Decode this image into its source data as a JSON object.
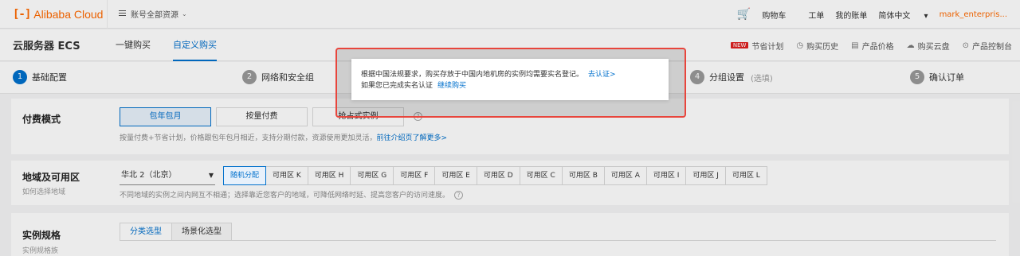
{
  "topbar": {
    "logo_mark": "[-]",
    "logo_text": "Alibaba Cloud",
    "account": "账号全部资源",
    "cart": "购物车",
    "ticket": "工单",
    "bill": "我的账单",
    "language": "简体中文",
    "user": "mark_enterpris..."
  },
  "subbar": {
    "product": "云服务器 ECS",
    "tabs": [
      "一键购买",
      "自定义购买"
    ],
    "active_tab": "自定义购买",
    "new_badge": "NEW",
    "links": [
      "节省计划",
      "购买历史",
      "产品价格",
      "购买云盘",
      "产品控制台"
    ]
  },
  "steps": [
    {
      "num": "1",
      "label": "基础配置"
    },
    {
      "num": "2",
      "label": "网络和安全组"
    },
    {
      "num": "4",
      "label": "分组设置",
      "optional": "(选填)"
    },
    {
      "num": "5",
      "label": "确认订单"
    }
  ],
  "billing": {
    "title": "付费模式",
    "options": [
      "包年包月",
      "按量付费",
      "抢占式实例"
    ],
    "hint": "按量付费+节省计划，价格跟包年包月相近，支持分期付款，资源使用更加灵活，",
    "hint_link": "前往介绍页了解更多>"
  },
  "region": {
    "title": "地域及可用区",
    "sub": "如何选择地域",
    "selected": "华北 2（北京）",
    "zones": [
      "随机分配",
      "可用区 K",
      "可用区 H",
      "可用区 G",
      "可用区 F",
      "可用区 E",
      "可用区 D",
      "可用区 C",
      "可用区 B",
      "可用区 A",
      "可用区 I",
      "可用区 J",
      "可用区 L"
    ],
    "hint": "不同地域的实例之间内网互不相通；选择靠近您客户的地域，可降低网络时延、提高您客户的访问速度。"
  },
  "spec": {
    "title": "实例规格",
    "sub": "实例规格族",
    "tabs": [
      "分类选型",
      "场景化选型"
    ]
  },
  "modal": {
    "line1": "根据中国法规要求，购买存放于中国内地机房的实例均需要实名登记。",
    "link1": "去认证>",
    "line2": "如果您已完成实名认证",
    "link2": "继续购买"
  }
}
